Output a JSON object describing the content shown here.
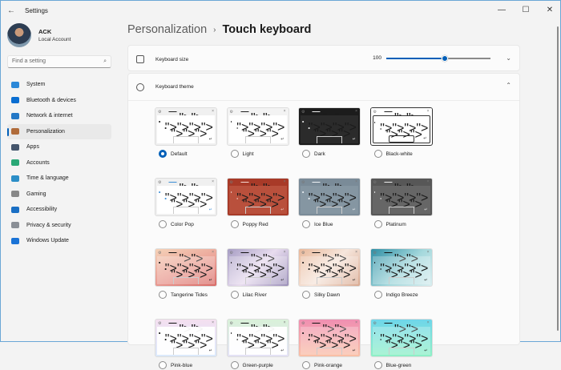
{
  "window": {
    "title": "Settings",
    "minimize": "—",
    "maximize": "☐",
    "close": "✕",
    "back": "←"
  },
  "profile": {
    "name": "ACK",
    "account": "Local Account"
  },
  "search": {
    "placeholder": "Find a setting",
    "icon": "search-icon"
  },
  "nav": [
    {
      "label": "System",
      "color": "#2b88d8"
    },
    {
      "label": "Bluetooth & devices",
      "color": "#0a6ed1"
    },
    {
      "label": "Network & internet",
      "color": "#2478c6"
    },
    {
      "label": "Personalization",
      "color": "#b06b3a",
      "selected": true
    },
    {
      "label": "Apps",
      "color": "#44556b"
    },
    {
      "label": "Accounts",
      "color": "#2aa876"
    },
    {
      "label": "Time & language",
      "color": "#2c8ec7"
    },
    {
      "label": "Gaming",
      "color": "#888888"
    },
    {
      "label": "Accessibility",
      "color": "#1a6fc4"
    },
    {
      "label": "Privacy & security",
      "color": "#8a8f96"
    },
    {
      "label": "Windows Update",
      "color": "#1a73d6"
    }
  ],
  "breadcrumb": {
    "parent": "Personalization",
    "separator": "›",
    "current": "Touch keyboard"
  },
  "keyboard_size": {
    "label": "Keyboard size",
    "value": "100",
    "percent": 56
  },
  "keyboard_theme": {
    "label": "Keyboard theme"
  },
  "accent": "#005fb8",
  "themes": [
    {
      "name": "Default",
      "selected": true,
      "head": "#f0f0f0",
      "body": "#ffffff",
      "ink": "#222"
    },
    {
      "name": "Light",
      "head": "#f3f3f3",
      "body": "#ffffff",
      "ink": "#222"
    },
    {
      "name": "Dark",
      "head": "#1c1c1c",
      "body": "#2b2b2b",
      "ink": "#eee"
    },
    {
      "name": "Black-white",
      "head": "#ffffff",
      "body": "#ffffff",
      "ink": "#222"
    },
    {
      "name": "Color Pop",
      "head": "#f0f0f0",
      "body": "#ffffff",
      "ink": "#3b8ed6"
    },
    {
      "name": "Poppy Red",
      "head": "#a83a28",
      "body": "#b9503c",
      "ink": "#f6d9d2"
    },
    {
      "name": "Ice Blue",
      "head": "#7a8b98",
      "body": "#8596a2",
      "ink": "#eef2f5"
    },
    {
      "name": "Platinum",
      "head": "#575757",
      "body": "#666666",
      "ink": "#eeeeee"
    },
    {
      "name": "Tangerine Tides",
      "head": "#e9b9a0",
      "body": "#f1b7a6",
      "ink": "#111"
    },
    {
      "name": "Lilac River",
      "head": "#b8b0cc",
      "body": "#cfc8dd",
      "ink": "#111"
    },
    {
      "name": "Silky Dawn",
      "head": "#e9c7b0",
      "body": "#f1dccd",
      "ink": "#111"
    },
    {
      "name": "Indigo Breeze",
      "head": "#4f9fb0",
      "body": "#8fcbd3",
      "ink": "#111"
    },
    {
      "name": "Pink-blue",
      "head": "#f0dcef",
      "body": "#ffffff",
      "ink": "#111"
    },
    {
      "name": "Green-purple",
      "head": "#d8f0d8",
      "body": "#ffffff",
      "ink": "#111"
    },
    {
      "name": "Pink-orange",
      "head": "#f09ab8",
      "body": "#f8c6b8",
      "ink": "#111"
    },
    {
      "name": "Blue-green",
      "head": "#7fdbe6",
      "body": "#9ff0d6",
      "ink": "#111"
    }
  ]
}
